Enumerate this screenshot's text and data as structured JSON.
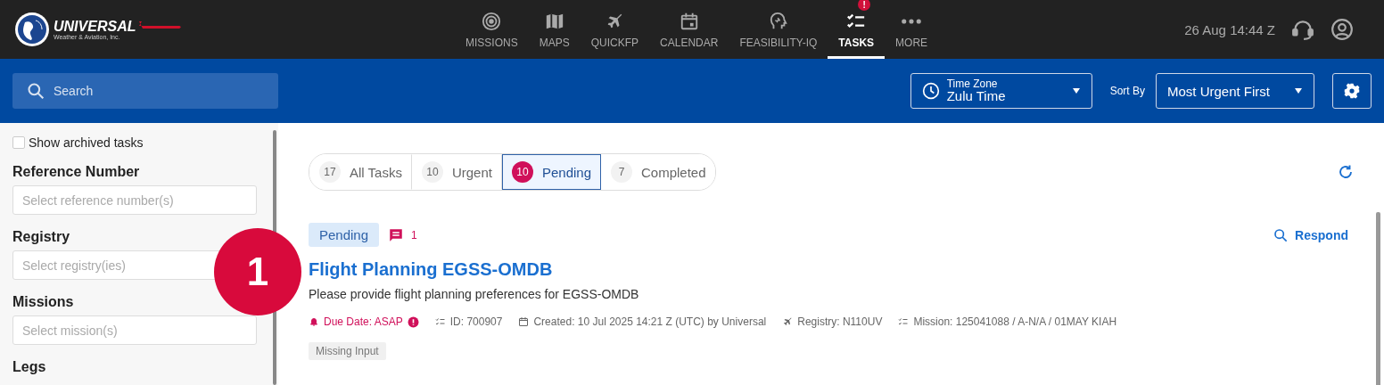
{
  "logo": {
    "name": "UNIVERSAL",
    "subtitle": "Weather & Aviation, Inc."
  },
  "nav": [
    {
      "label": "MISSIONS",
      "kind": "target",
      "selected": false
    },
    {
      "label": "MAPS",
      "kind": "map",
      "selected": false
    },
    {
      "label": "QUICKFP",
      "kind": "plane",
      "selected": false
    },
    {
      "label": "CALENDAR",
      "kind": "calendar",
      "selected": false
    },
    {
      "label": "FEASIBILITY-IQ",
      "kind": "head",
      "selected": false
    },
    {
      "label": "TASKS",
      "kind": "tasks",
      "selected": true,
      "badge": "!"
    },
    {
      "label": "MORE",
      "kind": "dots",
      "selected": false
    }
  ],
  "clock": "26 Aug 14:44 Z",
  "toolbar": {
    "search": {
      "placeholder": "Search"
    },
    "time_zone": {
      "label": "Time Zone",
      "value": "Zulu Time"
    },
    "sort_label": "Sort By",
    "sort_value": "Most Urgent First"
  },
  "sidebar": {
    "archived": {
      "label": "Show archived tasks",
      "checked": false
    },
    "filters": [
      {
        "label": "Reference Number",
        "placeholder": "Select reference number(s)"
      },
      {
        "label": "Registry",
        "placeholder": "Select registry(ies)"
      },
      {
        "label": "Missions",
        "placeholder": "Select mission(s)"
      },
      {
        "label": "Legs"
      }
    ]
  },
  "tabs": [
    {
      "count": "17",
      "label": "All Tasks",
      "selected": false
    },
    {
      "count": "10",
      "label": "Urgent",
      "selected": false
    },
    {
      "count": "10",
      "label": "Pending",
      "selected": true
    },
    {
      "count": "7",
      "label": "Completed",
      "selected": false
    }
  ],
  "task": {
    "status": "Pending",
    "comments": "1",
    "respond": "Respond",
    "title": "Flight Planning EGSS-OMDB",
    "description": "Please provide flight planning preferences for EGSS-OMDB",
    "meta": [
      {
        "kind": "due",
        "text": "Due Date: ASAP"
      },
      {
        "kind": "id",
        "text": "ID: 700907"
      },
      {
        "kind": "created",
        "text": "Created: 10 Jul 2025 14:21 Z (UTC) by Universal"
      },
      {
        "kind": "registry",
        "text": "Registry: N110UV"
      },
      {
        "kind": "mission",
        "text": "Mission: 125041088 / A-N/A / 01MAY KIAH"
      }
    ],
    "tags": [
      "Missing Input"
    ]
  },
  "annotation": "1"
}
